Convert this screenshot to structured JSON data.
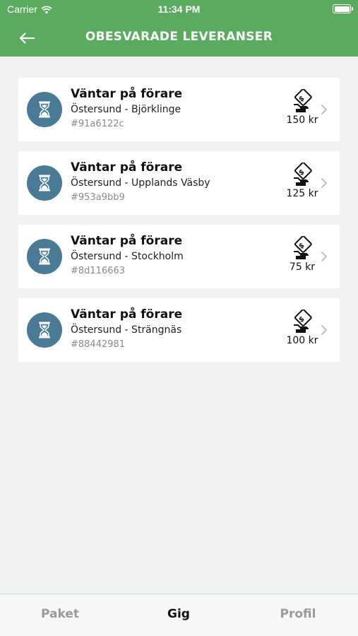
{
  "status_bar": {
    "carrier": "Carrier",
    "time": "11:34 PM"
  },
  "nav": {
    "title": "OBESVARADE LEVERANSER"
  },
  "deliveries": [
    {
      "status": "Väntar på förare",
      "route": "Östersund - Björklinge",
      "id": "#91a6122c",
      "price": "150 kr"
    },
    {
      "status": "Väntar på förare",
      "route": "Östersund - Upplands Väsby",
      "id": "#953a9bb9",
      "price": "125 kr"
    },
    {
      "status": "Väntar på förare",
      "route": "Östersund - Stockholm",
      "id": "#8d116663",
      "price": "75 kr"
    },
    {
      "status": "Väntar på förare",
      "route": "Östersund - Strängnäs",
      "id": "#88442981",
      "price": "100 kr"
    }
  ],
  "tabs": [
    {
      "label": "Paket",
      "active": false
    },
    {
      "label": "Gig",
      "active": true
    },
    {
      "label": "Profil",
      "active": false
    }
  ],
  "colors": {
    "header": "#5aaa5f",
    "avatar": "#4a7a96",
    "background": "#f2f2f2"
  },
  "icons": {
    "back": "arrow-left-icon",
    "status": "hourglass-icon",
    "payment": "money-hand-icon",
    "row": "chevron-right-icon"
  }
}
